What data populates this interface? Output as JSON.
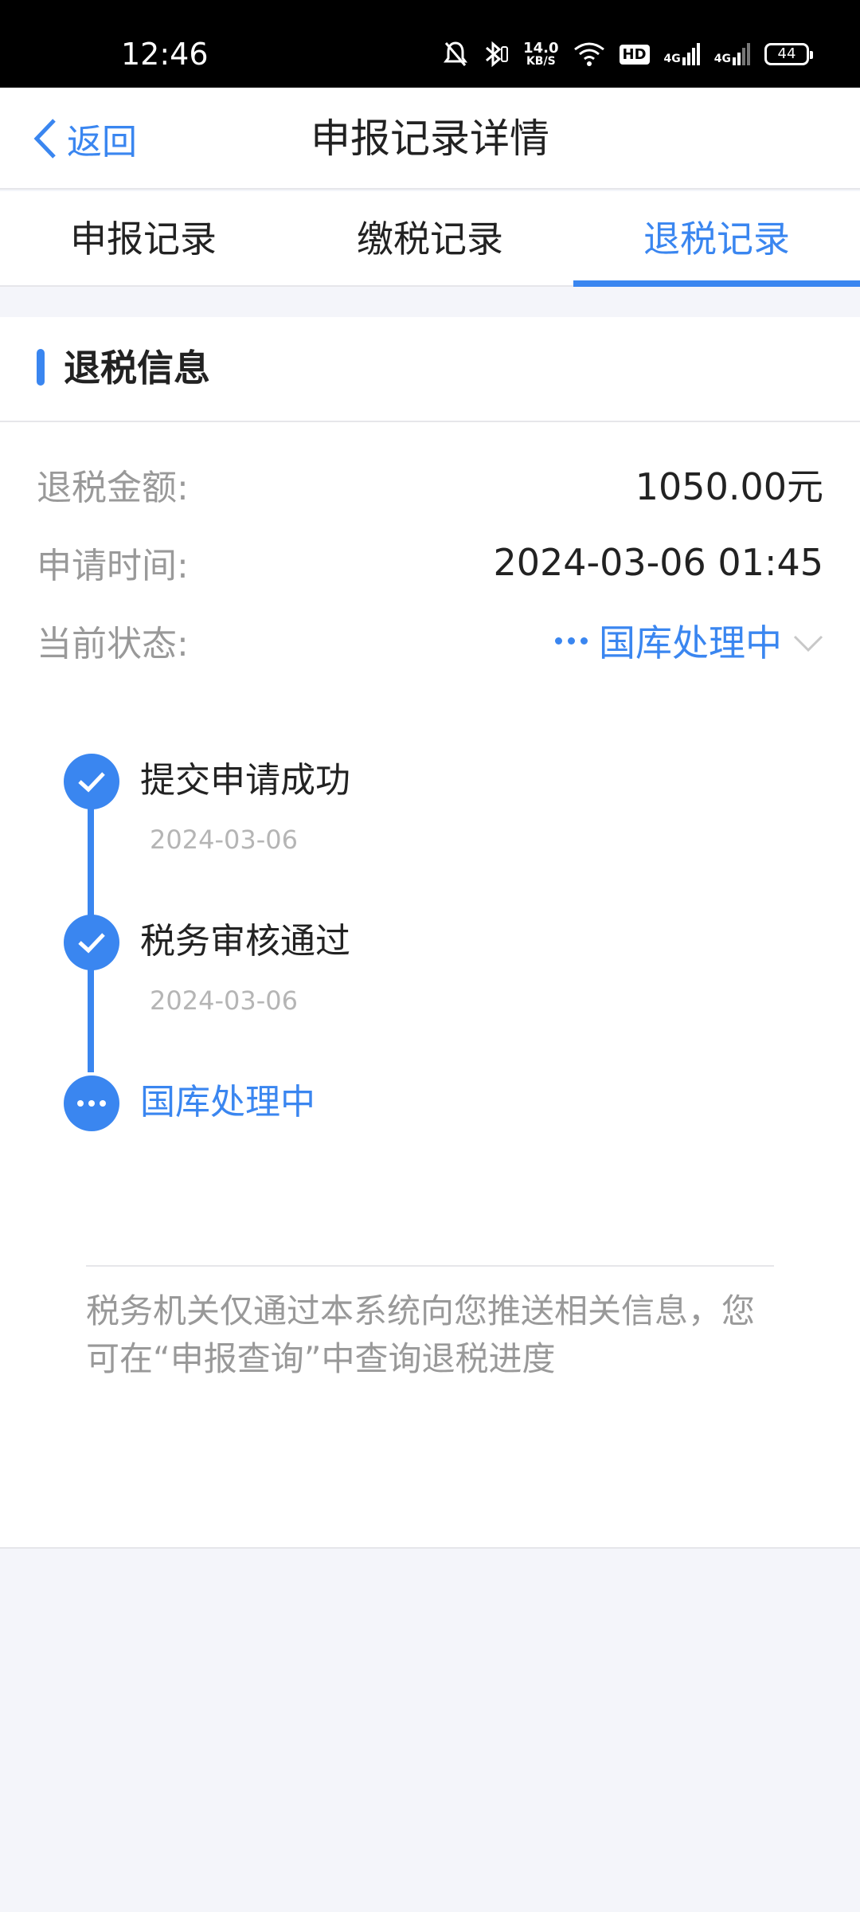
{
  "status_bar": {
    "time": "12:46",
    "net_speed": "14.0",
    "net_speed_unit": "KB/S",
    "hd_badge": "HD",
    "signal1": "4G",
    "signal2": "4G",
    "battery": "44"
  },
  "nav": {
    "back_label": "返回",
    "title": "申报记录详情"
  },
  "tabs": [
    {
      "label": "申报记录",
      "active": false
    },
    {
      "label": "缴税记录",
      "active": false
    },
    {
      "label": "退税记录",
      "active": true
    }
  ],
  "section": {
    "title": "退税信息"
  },
  "info": {
    "amount_label": "退税金额:",
    "amount_value": "1050.00元",
    "time_label": "申请时间:",
    "time_value": "2024-03-06 01:45",
    "status_label": "当前状态:",
    "status_value": "国库处理中"
  },
  "timeline": [
    {
      "name": "提交申请成功",
      "date": "2024-03-06",
      "state": "done"
    },
    {
      "name": "税务审核通过",
      "date": "2024-03-06",
      "state": "done"
    },
    {
      "name": "国库处理中",
      "date": "",
      "state": "in-progress"
    }
  ],
  "notice": "税务机关仅通过本系统向您推送相关信息，您可在“申报查询”中查询退税进度",
  "colors": {
    "accent": "#3a86f0",
    "muted": "#999999",
    "background": "#f4f5fa"
  }
}
